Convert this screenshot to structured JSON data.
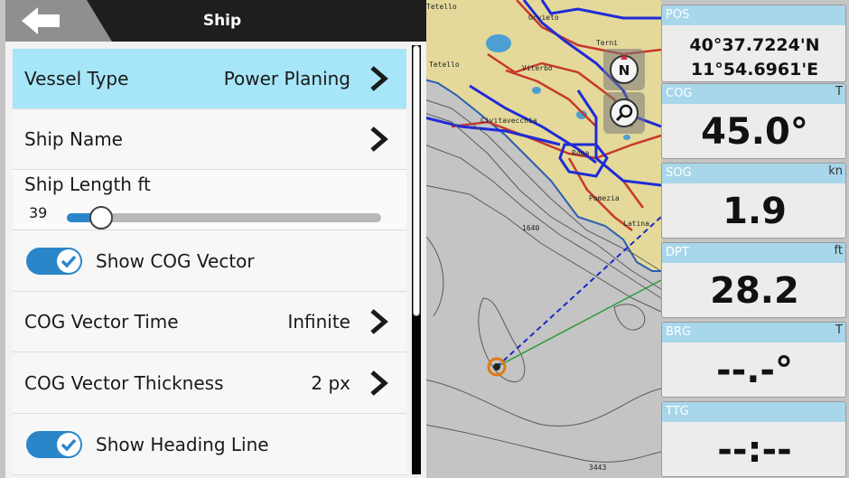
{
  "header": {
    "title": "Ship"
  },
  "settings": {
    "vessel_type": {
      "label": "Vessel Type",
      "value": "Power Planing"
    },
    "ship_name": {
      "label": "Ship Name"
    },
    "ship_length": {
      "label": "Ship Length ft",
      "value": "39",
      "fraction": 0.11
    },
    "show_cog_vector": {
      "label": "Show COG Vector",
      "on": true
    },
    "cog_vector_time": {
      "label": "COG Vector Time",
      "value": "Infinite"
    },
    "cog_vector_thickness": {
      "label": "COG Vector Thickness",
      "value": "2 px"
    },
    "show_heading_line": {
      "label": "Show Heading Line",
      "on": true
    }
  },
  "map": {
    "place_labels": [
      "Orvieto",
      "Terni",
      "Viterbo",
      "Civitavecchia",
      "Tetello",
      "Roma",
      "Pomezia",
      "Latina"
    ],
    "depth_labels": [
      "1640",
      "3443"
    ],
    "buttons": [
      "north-up-icon",
      "zoom-icon"
    ]
  },
  "data_panels": {
    "pos": {
      "name": "POS",
      "lat": "40°37.7224'N",
      "lon": "11°54.6961'E"
    },
    "cog": {
      "name": "COG",
      "unit": "T",
      "value": "45.0°"
    },
    "sog": {
      "name": "SOG",
      "unit": "kn",
      "value": "1.9"
    },
    "dpt": {
      "name": "DPT",
      "unit": "ft",
      "value": "28.2"
    },
    "brg": {
      "name": "BRG",
      "unit": "T",
      "value": "--.-°"
    },
    "ttg": {
      "name": "TTG",
      "unit": "",
      "value": "--:--"
    }
  },
  "colors": {
    "accent": "#2a86c9",
    "selected_row": "#a6e6f8",
    "panel_header": "#a8d6ea",
    "land": "#e6dc9c",
    "sea": "#c9c9c9"
  }
}
